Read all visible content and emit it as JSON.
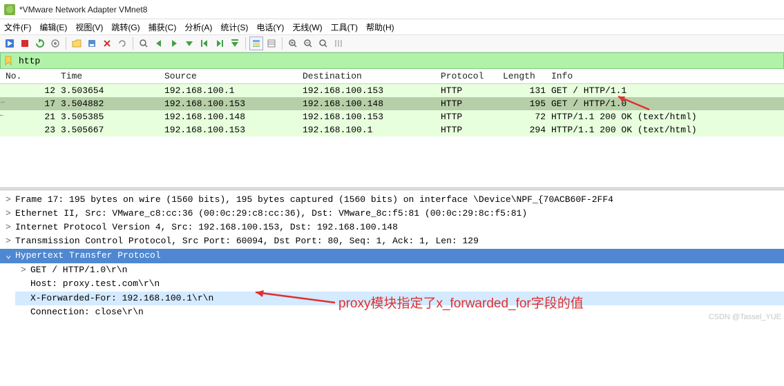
{
  "window": {
    "title": "*VMware Network Adapter VMnet8"
  },
  "menu": {
    "file": "文件(F)",
    "edit": "编辑(E)",
    "view": "视图(V)",
    "go": "跳转(G)",
    "capture": "捕获(C)",
    "analyze": "分析(A)",
    "stats": "统计(S)",
    "tel": "电话(Y)",
    "wireless": "无线(W)",
    "tools": "工具(T)",
    "help": "帮助(H)"
  },
  "filter": {
    "value": "http"
  },
  "columns": {
    "no": "No.",
    "time": "Time",
    "src": "Source",
    "dst": "Destination",
    "proto": "Protocol",
    "len": "Length",
    "info": "Info"
  },
  "packets": [
    {
      "no": "12",
      "time": "3.503654",
      "src": "192.168.100.1",
      "dst": "192.168.100.153",
      "proto": "HTTP",
      "len": "131",
      "info": "GET / HTTP/1.1",
      "cls": "row-light"
    },
    {
      "no": "17",
      "time": "3.504882",
      "src": "192.168.100.153",
      "dst": "192.168.100.148",
      "proto": "HTTP",
      "len": "195",
      "info": "GET / HTTP/1.0",
      "cls": "row-selected"
    },
    {
      "no": "21",
      "time": "3.505385",
      "src": "192.168.100.148",
      "dst": "192.168.100.153",
      "proto": "HTTP",
      "len": "72",
      "info": "HTTP/1.1 200 OK  (text/html)",
      "cls": "row-light"
    },
    {
      "no": "23",
      "time": "3.505667",
      "src": "192.168.100.153",
      "dst": "192.168.100.1",
      "proto": "HTTP",
      "len": "294",
      "info": "HTTP/1.1 200 OK  (text/html)",
      "cls": "row-light"
    }
  ],
  "details": {
    "frame": "Frame 17: 195 bytes on wire (1560 bits), 195 bytes captured (1560 bits) on interface \\Device\\NPF_{70ACB60F-2FF4",
    "eth": "Ethernet II, Src: VMware_c8:cc:36 (00:0c:29:c8:cc:36), Dst: VMware_8c:f5:81 (00:0c:29:8c:f5:81)",
    "ip": "Internet Protocol Version 4, Src: 192.168.100.153, Dst: 192.168.100.148",
    "tcp": "Transmission Control Protocol, Src Port: 60094, Dst Port: 80, Seq: 1, Ack: 1, Len: 129",
    "http": "Hypertext Transfer Protocol",
    "http_get": "GET / HTTP/1.0\\r\\n",
    "http_host": "Host: proxy.test.com\\r\\n",
    "http_xff": "X-Forwarded-For: 192.168.100.1\\r\\n",
    "http_conn": "Connection: close\\r\\n"
  },
  "annotation": "proxy模块指定了x_forwarded_for字段的值",
  "watermark": "CSDN @Tassel_YUE"
}
